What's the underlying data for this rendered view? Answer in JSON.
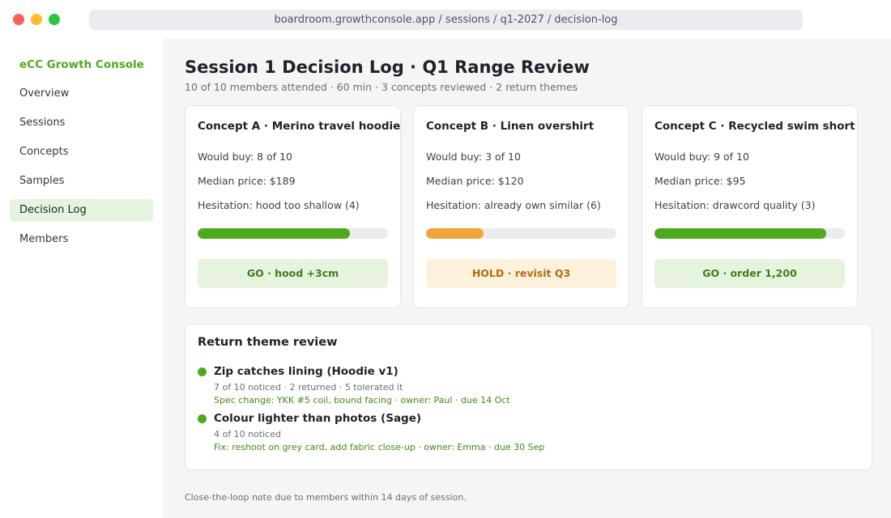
{
  "window": {
    "url": "boardroom.growthconsole.app / sessions / q1-2027 / decision-log"
  },
  "sidebar": {
    "brand": "eCC Growth Console",
    "items": [
      {
        "label": "Overview"
      },
      {
        "label": "Sessions"
      },
      {
        "label": "Concepts"
      },
      {
        "label": "Samples"
      },
      {
        "label": "Decision Log",
        "active": true
      },
      {
        "label": "Members"
      }
    ]
  },
  "header": {
    "title": "Session 1 Decision Log  ·  Q1 Range Review",
    "meta": "10 of 10 members attended  ·  60 min  ·  3 concepts reviewed  ·  2 return themes"
  },
  "concepts": [
    {
      "title": "Concept A · Merino travel hoodie",
      "would_buy": "Would buy: 8 of 10",
      "median_price": "Median price: $189",
      "hesitation": "Hesitation: hood too shallow (4)",
      "score_fraction": 0.8,
      "bar_color": "#4caa1c",
      "verdict": "GO · hood +3cm",
      "verdict_status": "go"
    },
    {
      "title": "Concept B · Linen overshirt",
      "would_buy": "Would buy: 3 of 10",
      "median_price": "Median price: $120",
      "hesitation": "Hesitation: already own similar (6)",
      "score_fraction": 0.3,
      "bar_color": "#f0a43a",
      "verdict": "HOLD · revisit Q3",
      "verdict_status": "hold"
    },
    {
      "title": "Concept C · Recycled swim short",
      "would_buy": "Would buy: 9 of 10",
      "median_price": "Median price: $95",
      "hesitation": "Hesitation: drawcord quality (3)",
      "score_fraction": 0.9,
      "bar_color": "#4caa1c",
      "verdict": "GO · order 1,200",
      "verdict_status": "go"
    }
  ],
  "themes": {
    "title": "Return theme review",
    "items": [
      {
        "title": "Zip catches lining (Hoodie v1)",
        "stats": "7 of 10 noticed · 2 returned · 5 tolerated it",
        "action": "Spec change: YKK #5 coil, bound facing · owner: Paul · due 14 Oct"
      },
      {
        "title": "Colour lighter than photos (Sage)",
        "stats": "4 of 10 noticed",
        "action": "Fix: reshoot on grey card, add fabric close-up · owner: Emma · due 30 Sep"
      }
    ]
  },
  "footnote": "Close-the-loop note due to members within 14 days of session.",
  "colors": {
    "accent": "#4caa1c",
    "hold": "#f0a43a"
  }
}
